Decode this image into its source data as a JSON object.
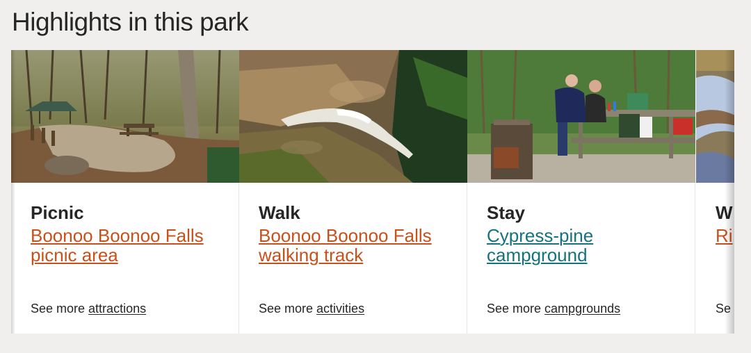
{
  "section": {
    "title": "Highlights in this park"
  },
  "cards": [
    {
      "category": "Picnic",
      "link": "Boonoo Boonoo Falls picnic area",
      "more_prefix": "See more ",
      "more_link": "attractions",
      "image": "picnic-area-photo",
      "link_color": "#c8511b"
    },
    {
      "category": "Walk",
      "link": "Boonoo Boonoo Falls walking track",
      "more_prefix": "See more ",
      "more_link": "activities",
      "image": "waterfall-photo",
      "link_color": "#c8511b"
    },
    {
      "category": "Stay",
      "link": "Cypress-pine campground",
      "more_prefix": "See more ",
      "more_link": "campgrounds",
      "image": "campground-photo",
      "link_color": "#14737c"
    },
    {
      "category": "W",
      "link": "Ri",
      "more_prefix": "Se",
      "more_link": "",
      "image": "river-photo",
      "link_color": "#c8511b"
    }
  ]
}
